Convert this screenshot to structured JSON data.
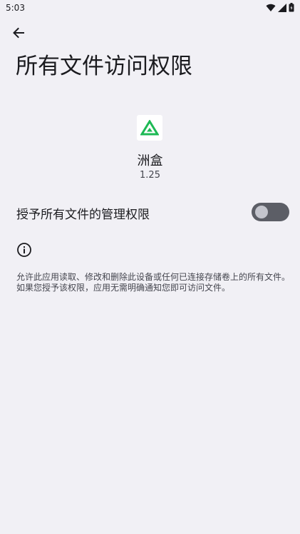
{
  "status_bar": {
    "time": "5:03",
    "icons": [
      "wifi-icon",
      "cellular-signal-icon",
      "battery-icon"
    ]
  },
  "header": {
    "back_icon": "arrow-back-icon",
    "title": "所有文件访问权限"
  },
  "app": {
    "name": "洲盒",
    "version": "1.25",
    "accent_color": "#1DB954"
  },
  "setting": {
    "label": "授予所有文件的管理权限",
    "toggle_state": "off"
  },
  "info": {
    "icon": "info-icon",
    "text": "允许此应用读取、修改和删除此设备或任何已连接存储卷上的所有文件。如果您授予该权限，应用无需明确通知您即可访问文件。"
  },
  "colors": {
    "background": "#F1F0F5",
    "toggle_track": "#5C5E66",
    "toggle_thumb": "#C4C5CD"
  }
}
